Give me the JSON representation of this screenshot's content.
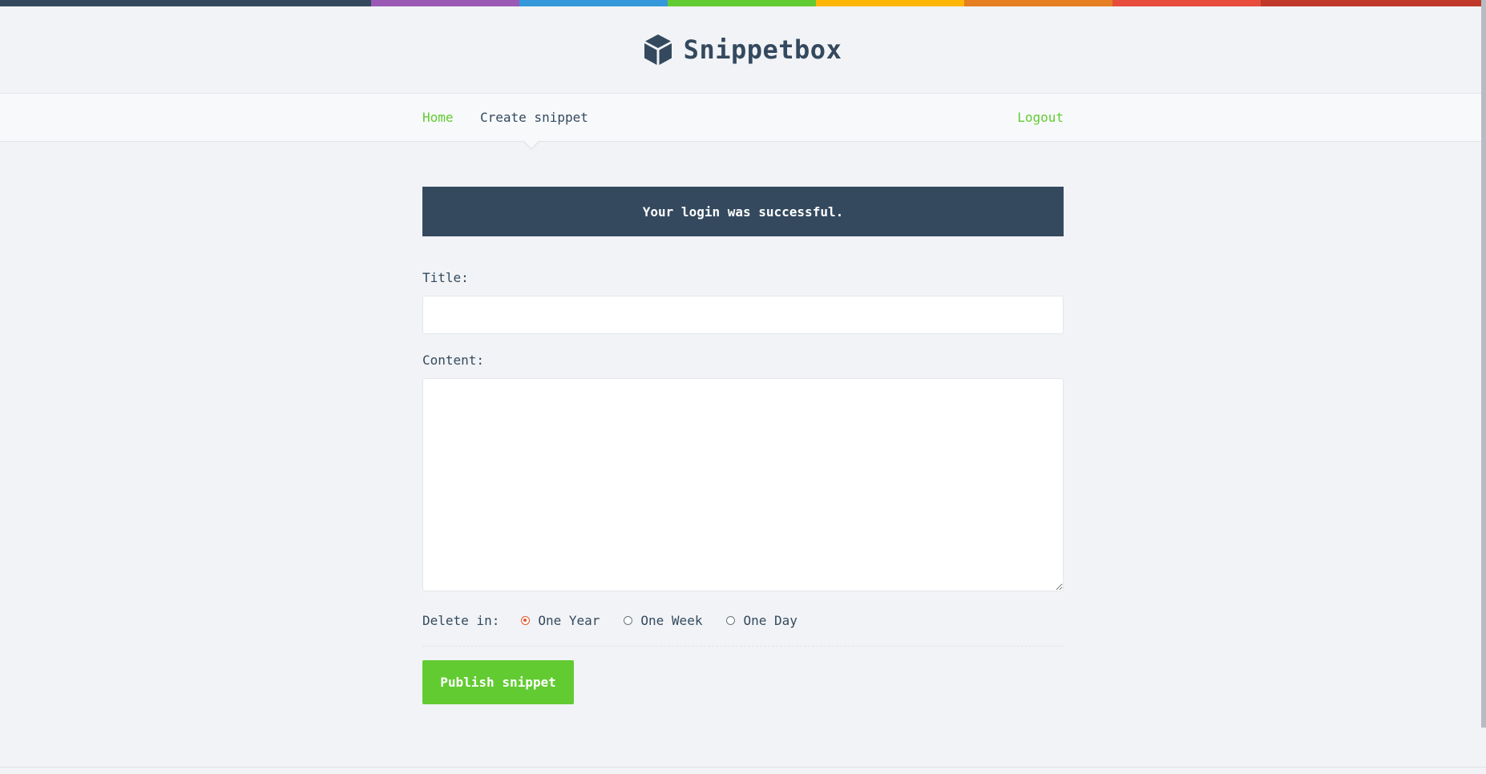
{
  "stripe_colors": [
    "#34495e",
    "#9b59b6",
    "#3498db",
    "#62cb31",
    "#ffb606",
    "#e67e22",
    "#e74c3c",
    "#c0392b"
  ],
  "brand": {
    "name": "Snippetbox",
    "icon": "cube-icon"
  },
  "nav": {
    "home": "Home",
    "create": "Create snippet",
    "logout": "Logout"
  },
  "flash": "Your login was successful.",
  "form": {
    "title_label": "Title:",
    "title_value": "",
    "content_label": "Content:",
    "content_value": "",
    "delete_label": "Delete in:",
    "expires_options": [
      {
        "label": "One Year",
        "checked": true
      },
      {
        "label": "One Week",
        "checked": false
      },
      {
        "label": "One Day",
        "checked": false
      }
    ],
    "submit_label": "Publish snippet"
  },
  "colors": {
    "accent": "#62cb31",
    "primary": "#34495e",
    "radio_selected": "#e6562c"
  }
}
